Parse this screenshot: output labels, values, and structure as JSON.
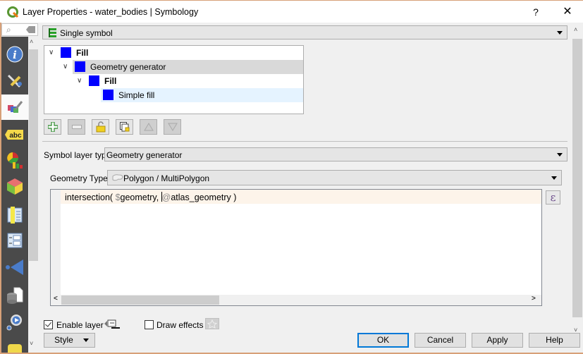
{
  "window": {
    "title": "Layer Properties - water_bodies | Symbology",
    "help_label": "?",
    "close_label": "✕"
  },
  "sidebar": {
    "search_placeholder": "",
    "items": [
      {
        "name": "information",
        "icon": "info-icon"
      },
      {
        "name": "source",
        "icon": "wrench-screwdriver-icon"
      },
      {
        "name": "symbology",
        "icon": "paintbrush-icon",
        "active": true
      },
      {
        "name": "labels",
        "icon": "abc-label-icon"
      },
      {
        "name": "diagrams",
        "icon": "pie-bar-chart-icon"
      },
      {
        "name": "3d-view",
        "icon": "cube-icon"
      },
      {
        "name": "fields",
        "icon": "fields-table-icon"
      },
      {
        "name": "attributes-form",
        "icon": "form-icon"
      },
      {
        "name": "joins",
        "icon": "join-arrow-icon"
      },
      {
        "name": "auxiliary-storage",
        "icon": "database-file-icon"
      },
      {
        "name": "actions",
        "icon": "gear-play-icon"
      },
      {
        "name": "display",
        "icon": "tooltip-icon"
      }
    ]
  },
  "renderer": {
    "selected": "Single symbol"
  },
  "symbol_tree": [
    {
      "label": "Fill",
      "bold": true,
      "level": 0,
      "expanded": true,
      "color": "#0000ff"
    },
    {
      "label": "Geometry generator",
      "bold": false,
      "level": 1,
      "expanded": true,
      "color": "#0000ff",
      "selected": true
    },
    {
      "label": "Fill",
      "bold": true,
      "level": 2,
      "expanded": true,
      "color": "#0000ff"
    },
    {
      "label": "Simple fill",
      "bold": false,
      "level": 3,
      "color": "#0000ff",
      "hover": true
    }
  ],
  "toolbar": {
    "add": "add-symbol-layer",
    "remove": "remove-symbol-layer",
    "lock": "lock-layer-color",
    "duplicate": "duplicate-symbol-layer",
    "move_up": "move-up",
    "move_down": "move-down"
  },
  "symbol_layer_type": {
    "label": "Symbol layer type",
    "selected": "Geometry generator"
  },
  "geometry_type": {
    "label": "Geometry Type",
    "selected": "Polygon / MultiPolygon"
  },
  "expression": {
    "func": "intersection( ",
    "var1": "$",
    "part1": "geometry, ",
    "var2": "@",
    "part2": "atlas_geometry )",
    "epsilon_label": "ε"
  },
  "enable_layer": {
    "label": "Enable layer",
    "checked": true
  },
  "draw_effects": {
    "label": "Draw effects",
    "checked": false
  },
  "buttons": {
    "style": "Style",
    "ok": "OK",
    "cancel": "Cancel",
    "apply": "Apply",
    "help": "Help"
  },
  "colors": {
    "symbol_fill": "#0000ff",
    "selection_bg": "#d9d9d9",
    "hover_bg": "#e5f3ff",
    "accent": "#0078d7",
    "window_border": "#d7a078"
  }
}
